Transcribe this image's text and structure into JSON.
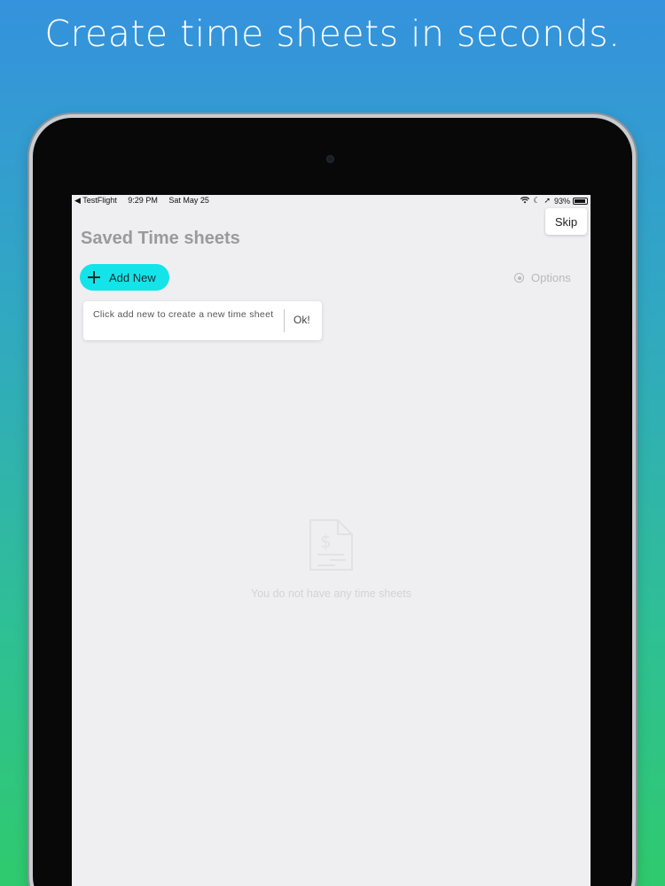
{
  "headline": "Create time sheets in seconds.",
  "status_bar": {
    "back_app": "◀ TestFlight",
    "time": "9:29 PM",
    "date": "Sat May 25",
    "battery": "93%",
    "battery_level": 0.93
  },
  "skip_label": "Skip",
  "page_title": "Saved Time sheets",
  "add_new_label": "Add New",
  "options_label": "Options",
  "tooltip": {
    "message": "Click add new to create a new time sheet",
    "ok_label": "Ok!"
  },
  "empty_state": {
    "message": "You do not have any time sheets"
  },
  "colors": {
    "accent": "#13e4ea",
    "gradient_top": "#3592dd",
    "gradient_bottom": "#2fca6e"
  }
}
